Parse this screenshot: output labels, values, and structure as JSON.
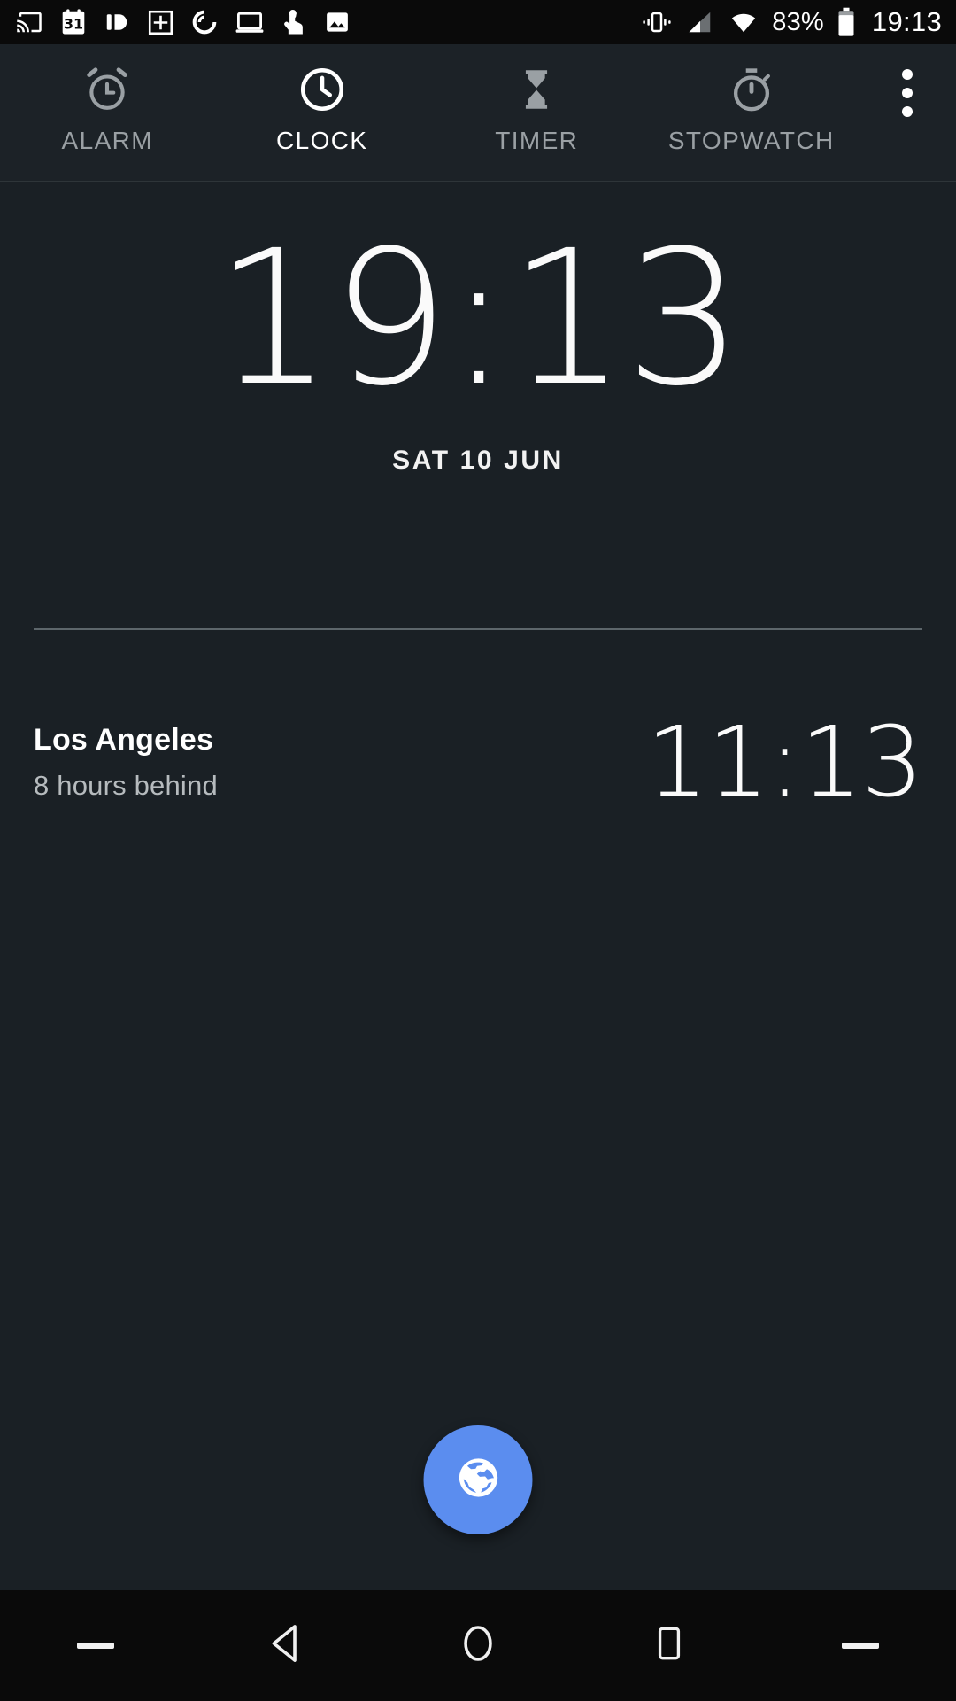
{
  "status_bar": {
    "notification_icons": [
      {
        "name": "cast-icon",
        "label": "Cast"
      },
      {
        "name": "calendar-icon",
        "label": "31"
      },
      {
        "name": "pushbullet-icon",
        "label": "Pushbullet"
      },
      {
        "name": "grid-photo-icon",
        "label": "Grid"
      },
      {
        "name": "pocket-casts-icon",
        "label": "Pocket Casts"
      },
      {
        "name": "laptop-icon",
        "label": "Laptop"
      },
      {
        "name": "touch-pointer-icon",
        "label": "Pointer"
      },
      {
        "name": "image-icon",
        "label": "Image"
      }
    ],
    "vibrate_icon": "vibrate-icon",
    "signal_icon": "signal-icon",
    "wifi_icon": "wifi-icon",
    "battery_percent": "83%",
    "battery_icon": "battery-icon",
    "time": "19:13"
  },
  "tabs": [
    {
      "label": "ALARM",
      "icon": "alarm-clock-icon",
      "active": false
    },
    {
      "label": "CLOCK",
      "icon": "clock-icon",
      "active": true
    },
    {
      "label": "TIMER",
      "icon": "hourglass-timer-icon",
      "active": false
    },
    {
      "label": "STOPWATCH",
      "icon": "stopwatch-icon",
      "active": false
    }
  ],
  "overflow_menu": {
    "name": "overflow-menu-icon",
    "label": "More options"
  },
  "main_clock": {
    "time": "19:13",
    "date": "SAT 10 JUN"
  },
  "world_clocks": [
    {
      "city": "Los Angeles",
      "offset": "8 hours behind",
      "time": "11:13"
    }
  ],
  "fab": {
    "name": "add-city-fab",
    "icon": "globe-icon",
    "color": "#5b8def"
  },
  "nav_bar": {
    "left_dash": "dash-icon",
    "back": "back-triangle-icon",
    "home": "home-circle-icon",
    "recents": "recents-square-icon",
    "right_dash": "dash-icon"
  },
  "colors": {
    "background": "#1a2025",
    "tabbar": "#1c2227",
    "statusbar": "#0a0a0a",
    "accent": "#5b8def",
    "active_text": "#ffffff",
    "inactive_text": "#9aa0a4",
    "secondary_text": "#b6bbbe",
    "divider": "#5d666b"
  }
}
